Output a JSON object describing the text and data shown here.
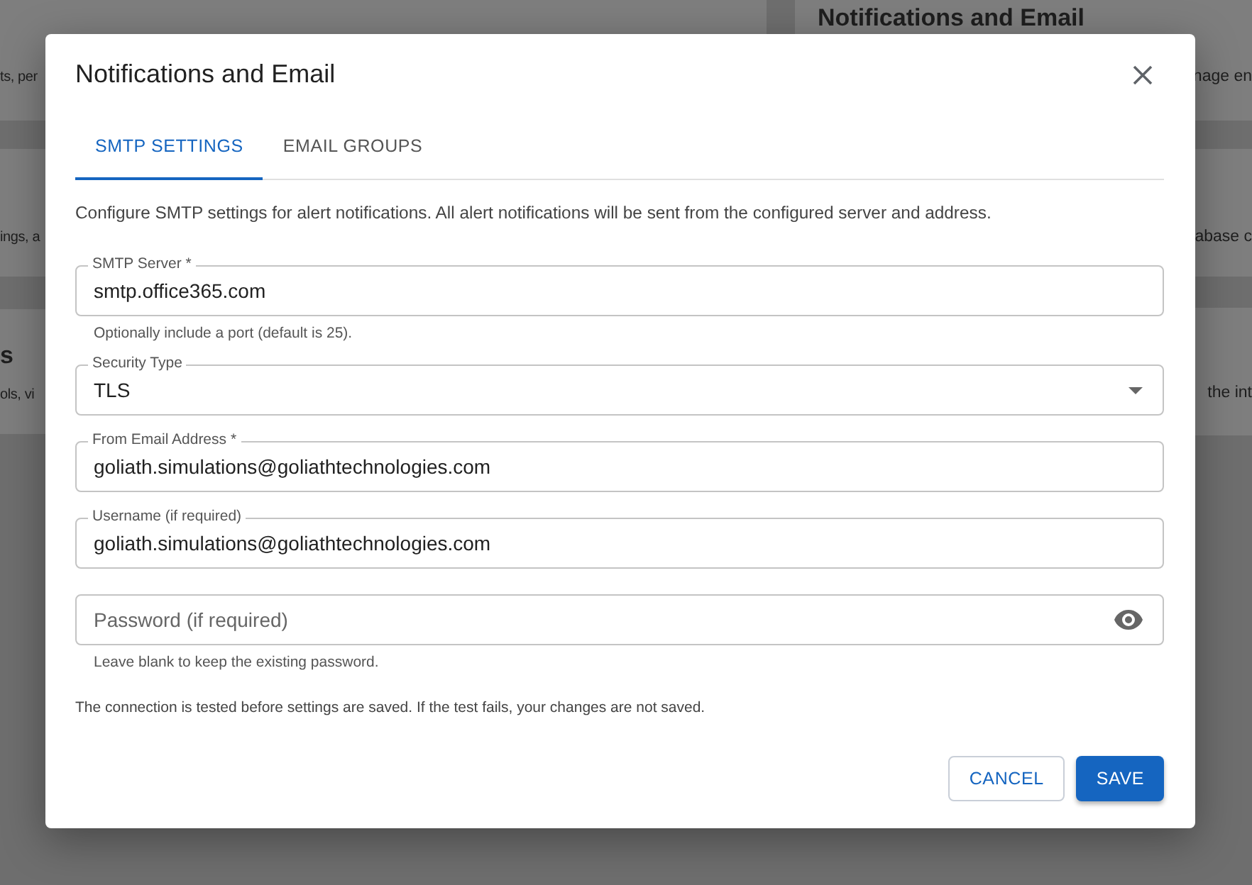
{
  "background": {
    "left_cards": [
      {
        "text": "ts, per"
      },
      {
        "text": "ings, a"
      },
      {
        "title": "s",
        "text": "ols, vi"
      }
    ],
    "right_cards": [
      {
        "title": "Notifications and Email",
        "text": "nage en"
      },
      {
        "text": "abase c"
      },
      {
        "text": "the int"
      }
    ]
  },
  "dialog": {
    "title": "Notifications and Email",
    "tabs": [
      {
        "label": "SMTP SETTINGS",
        "selected": true
      },
      {
        "label": "EMAIL GROUPS",
        "selected": false
      }
    ],
    "intro": "Configure SMTP settings for alert notifications. All alert notifications will be sent from the configured server and address.",
    "fields": [
      {
        "kind": "text",
        "label": "SMTP Server *",
        "value": "smtp.office365.com",
        "helper": "Optionally include a port (default is 25)."
      },
      {
        "kind": "select",
        "label": "Security Type",
        "value": "TLS"
      },
      {
        "kind": "text",
        "label": "From Email Address *",
        "value": "goliath.simulations@goliathtechnologies.com"
      },
      {
        "kind": "text",
        "label": "Username (if required)",
        "value": "goliath.simulations@goliathtechnologies.com"
      },
      {
        "kind": "password",
        "placeholder": "Password (if required)",
        "helper": "Leave blank to keep the existing password."
      }
    ],
    "note": "The connection is tested before settings are saved. If the test fails, your changes are not saved.",
    "buttons": [
      {
        "label": "CANCEL",
        "kind": "outlined"
      },
      {
        "label": "SAVE",
        "kind": "contained"
      }
    ]
  }
}
